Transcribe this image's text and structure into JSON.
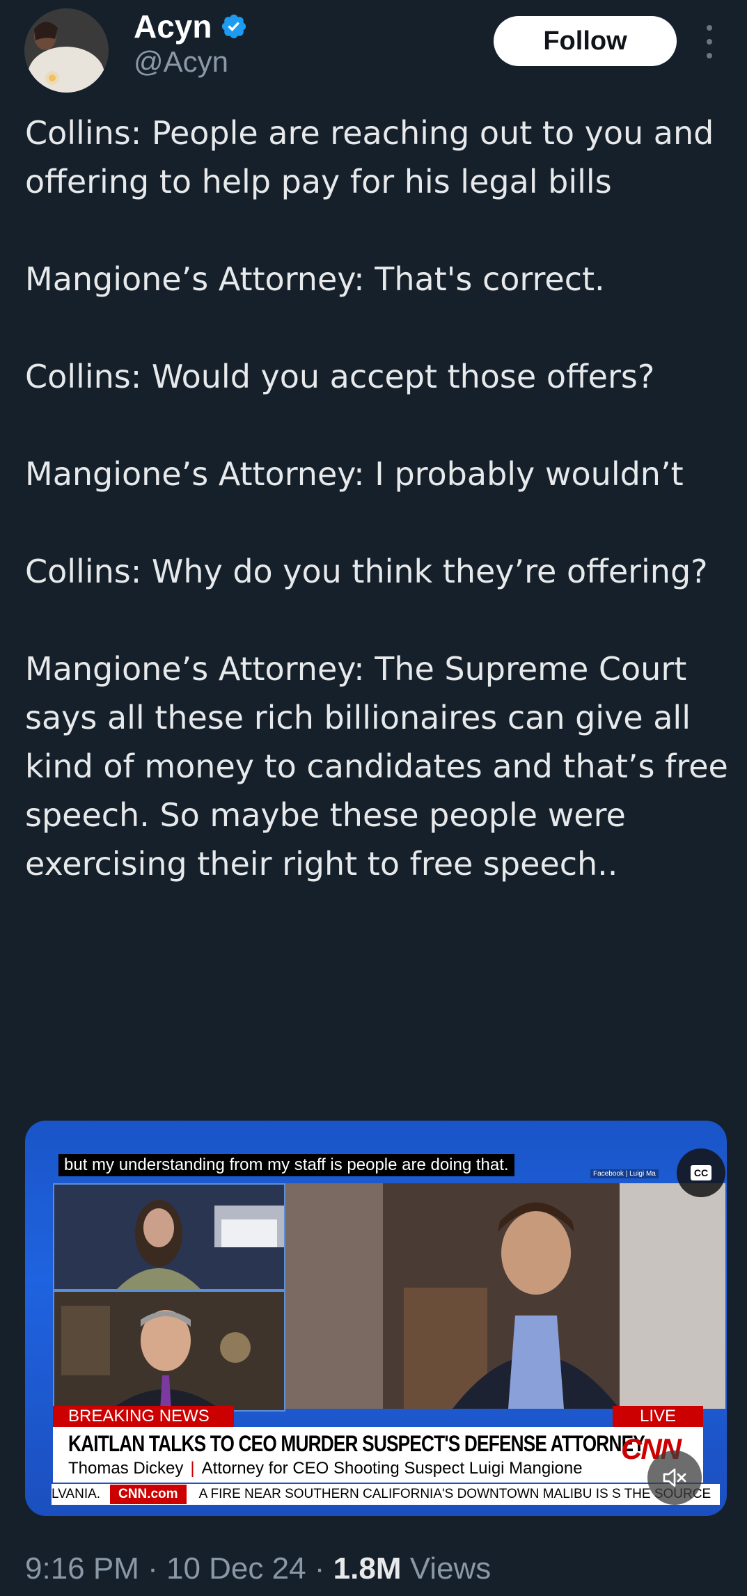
{
  "colors": {
    "background": "#15202b",
    "text_primary": "#e7e9ea",
    "text_secondary": "#8b98a5",
    "verified_blue": "#1d9bf0",
    "follow_bg": "#ffffff",
    "cnn_red": "#cc0000"
  },
  "author": {
    "name": "Acyn",
    "handle": "@Acyn",
    "verified": true,
    "verified_icon": "verified-badge-icon",
    "avatar": "avatar-photo"
  },
  "header": {
    "follow_label": "Follow",
    "more_icon": "more-vertical-icon"
  },
  "tweet": {
    "paragraphs": [
      "Collins: People are reaching out to you and offering to help pay for his legal bills",
      "Mangione’s Attorney: That's correct.",
      "Collins: Would you accept those offers?",
      "Mangione’s Attorney: I probably wouldn’t",
      "Collins: Why do you think they’re offering?",
      "Mangione’s Attorney: The Supreme Court says all these rich billionaires can give all kind of money to candidates and that’s free speech. So maybe these people were exercising their right to free speech.."
    ]
  },
  "video": {
    "caption": "but my understanding from my staff is people are doing that.",
    "photo_credit": "Facebook | Luigi Ma",
    "cc_label": "CC",
    "breaking_label": "BREAKING NEWS",
    "live_label": "LIVE",
    "headline": "KAITLAN TALKS TO CEO MURDER SUSPECT'S DEFENSE ATTORNEY",
    "guest_name": "Thomas Dickey",
    "guest_title": "Attorney for CEO Shooting Suspect Luigi Mangione",
    "network_logo": "CNN",
    "ticker_left": "LVANIA.",
    "ticker_brand": "CNN.com",
    "ticker_text": "A FIRE NEAR SOUTHERN CALIFORNIA'S DOWNTOWN MALIBU IS S THE SOURCE",
    "mute_icon": "speaker-muted-icon"
  },
  "meta": {
    "time": "9:16 PM",
    "date": "10 Dec 24",
    "views_count": "1.8M",
    "views_label": "Views"
  }
}
